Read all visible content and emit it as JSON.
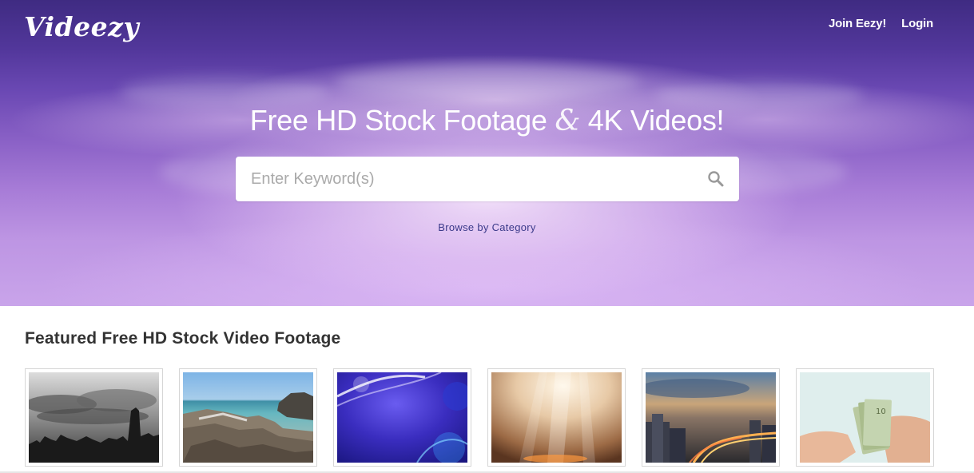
{
  "header": {
    "logo_text": "Videezy",
    "nav": [
      {
        "label": "Join Eezy!"
      },
      {
        "label": "Login"
      }
    ]
  },
  "hero": {
    "title_part1": "Free HD Stock Footage",
    "title_amp": "&",
    "title_part2": "4K Videos!",
    "search": {
      "placeholder": "Enter Keyword(s)",
      "value": "",
      "icon": "search-icon"
    },
    "browse_label": "Browse by Category"
  },
  "featured": {
    "title": "Featured Free HD Stock Video Footage",
    "thumbnails": [
      {
        "subject": "city-skyline-clouds"
      },
      {
        "subject": "rocky-beach"
      },
      {
        "subject": "blue-light-abstract"
      },
      {
        "subject": "golden-light-rays"
      },
      {
        "subject": "city-highway-dusk"
      },
      {
        "subject": "hands-counting-money"
      }
    ]
  },
  "colors": {
    "hero_top": "#3f2b82",
    "hero_bottom": "#c9a4ea",
    "link": "#3b3a8a",
    "heading": "#333333"
  }
}
